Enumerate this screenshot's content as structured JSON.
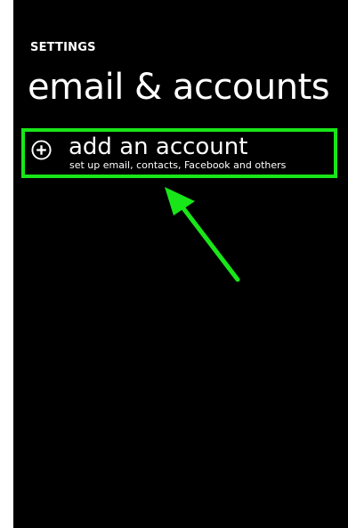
{
  "header": {
    "section_label": "SETTINGS",
    "title": "email & accounts"
  },
  "add_account": {
    "icon": "plus-circle-icon",
    "label": "add an account",
    "description": "set up email, contacts, Facebook and others"
  },
  "colors": {
    "background": "#000000",
    "text": "#ffffff",
    "highlight": "#19e619"
  }
}
